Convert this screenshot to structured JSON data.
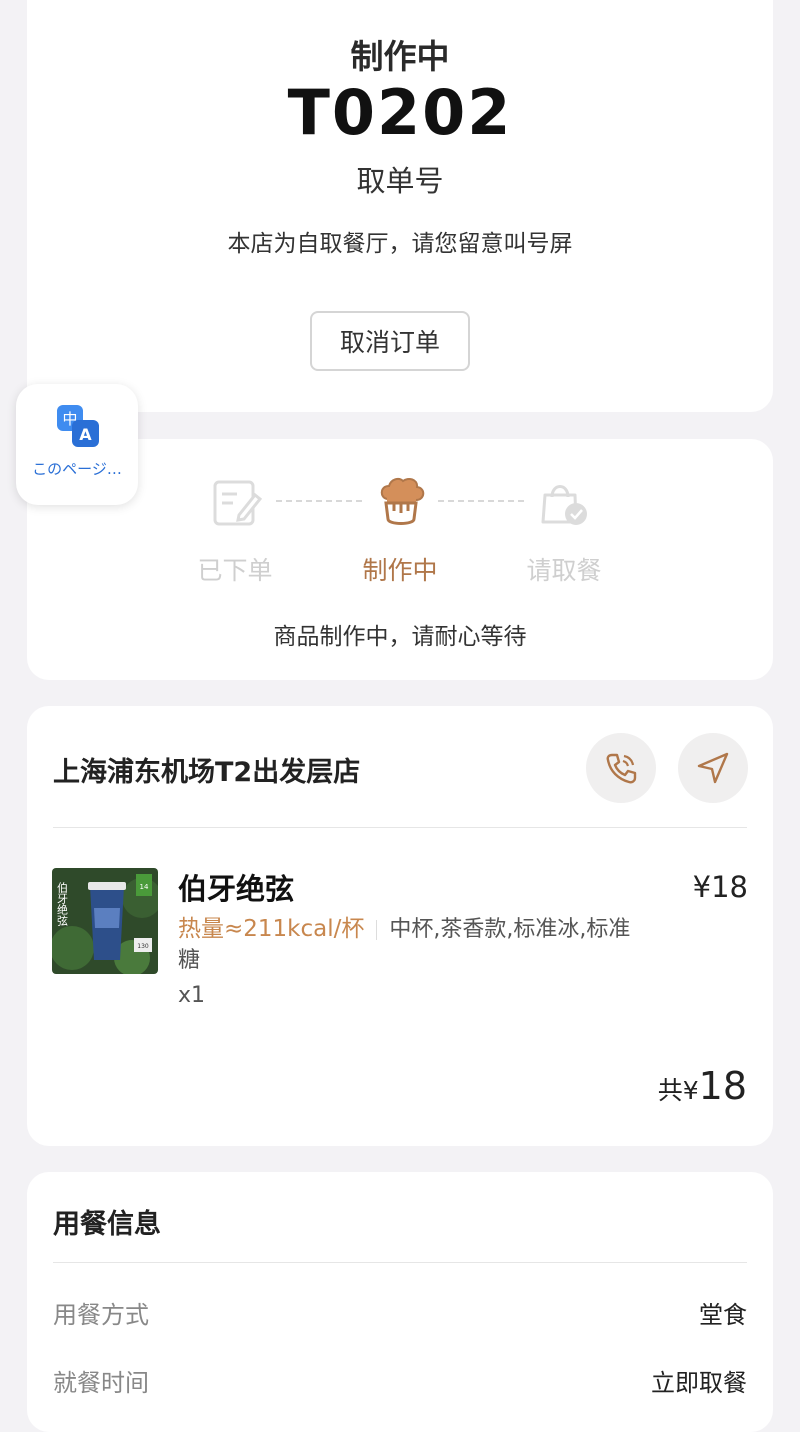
{
  "status_card": {
    "status_title": "制作中",
    "order_number": "T0202",
    "order_number_label": "取单号",
    "store_notice": "本店为自取餐厅，请您留意叫号屏",
    "cancel_button_label": "取消订单"
  },
  "progress": {
    "steps": [
      {
        "label": "已下单",
        "icon": "order-placed-icon",
        "state": "done"
      },
      {
        "label": "制作中",
        "icon": "chef-hat-icon",
        "state": "active"
      },
      {
        "label": "请取餐",
        "icon": "pickup-bag-icon",
        "state": "pending"
      }
    ],
    "message": "商品制作中，请耐心等待"
  },
  "order": {
    "store_name": "上海浦东机场T2出发层店",
    "call_icon": "phone-icon",
    "navigate_icon": "navigation-arrow-icon",
    "item": {
      "name": "伯牙绝弦",
      "price": "¥18",
      "calories": "热量≈211kcal/杯",
      "specs": "中杯,茶香款,标准冰,标准糖",
      "quantity": "x1",
      "image_text": "伯牙绝弦",
      "image_badge": "14",
      "image_kcal": "130"
    },
    "total_prefix": "共¥",
    "total_value": "18"
  },
  "dining_info": {
    "title": "用餐信息",
    "rows": [
      {
        "label": "用餐方式",
        "value": "堂食"
      },
      {
        "label": "就餐时间",
        "value": "立即取餐"
      }
    ]
  },
  "translate_widget": {
    "label": "このページ…",
    "icon": "translate-icon"
  },
  "colors": {
    "accent": "#b0774a",
    "background": "#f3f2f5",
    "translate_blue": "#2a6fd6"
  }
}
